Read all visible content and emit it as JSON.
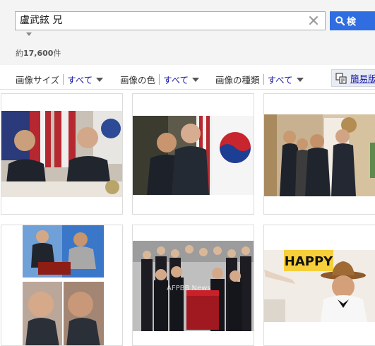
{
  "search": {
    "query": "盧武鉉 兄",
    "button_label": "検"
  },
  "results": {
    "count_prefix": "約",
    "count_value": "17,600",
    "count_suffix": "件"
  },
  "filters": [
    {
      "label": "画像サイズ",
      "value": "すべて"
    },
    {
      "label": "画像の色",
      "value": "すべて"
    },
    {
      "label": "画像の種類",
      "value": "すべて"
    }
  ],
  "view_toggle": {
    "label": "簡易版"
  },
  "image_results": [
    {
      "description": "two leaders seated before flags"
    },
    {
      "description": "two leaders standing before flags"
    },
    {
      "description": "leaders greeting in hallway"
    },
    {
      "description": "photo collage of portraits"
    },
    {
      "description": "funeral procession with coffin",
      "watermark": "AFPBB News"
    },
    {
      "description": "man in hat with sign",
      "sign_text": "HAPPY"
    }
  ],
  "colors": {
    "search_button": "#2f6de1",
    "link": "#1a1aa6",
    "header_background": "#f4f4f4"
  }
}
